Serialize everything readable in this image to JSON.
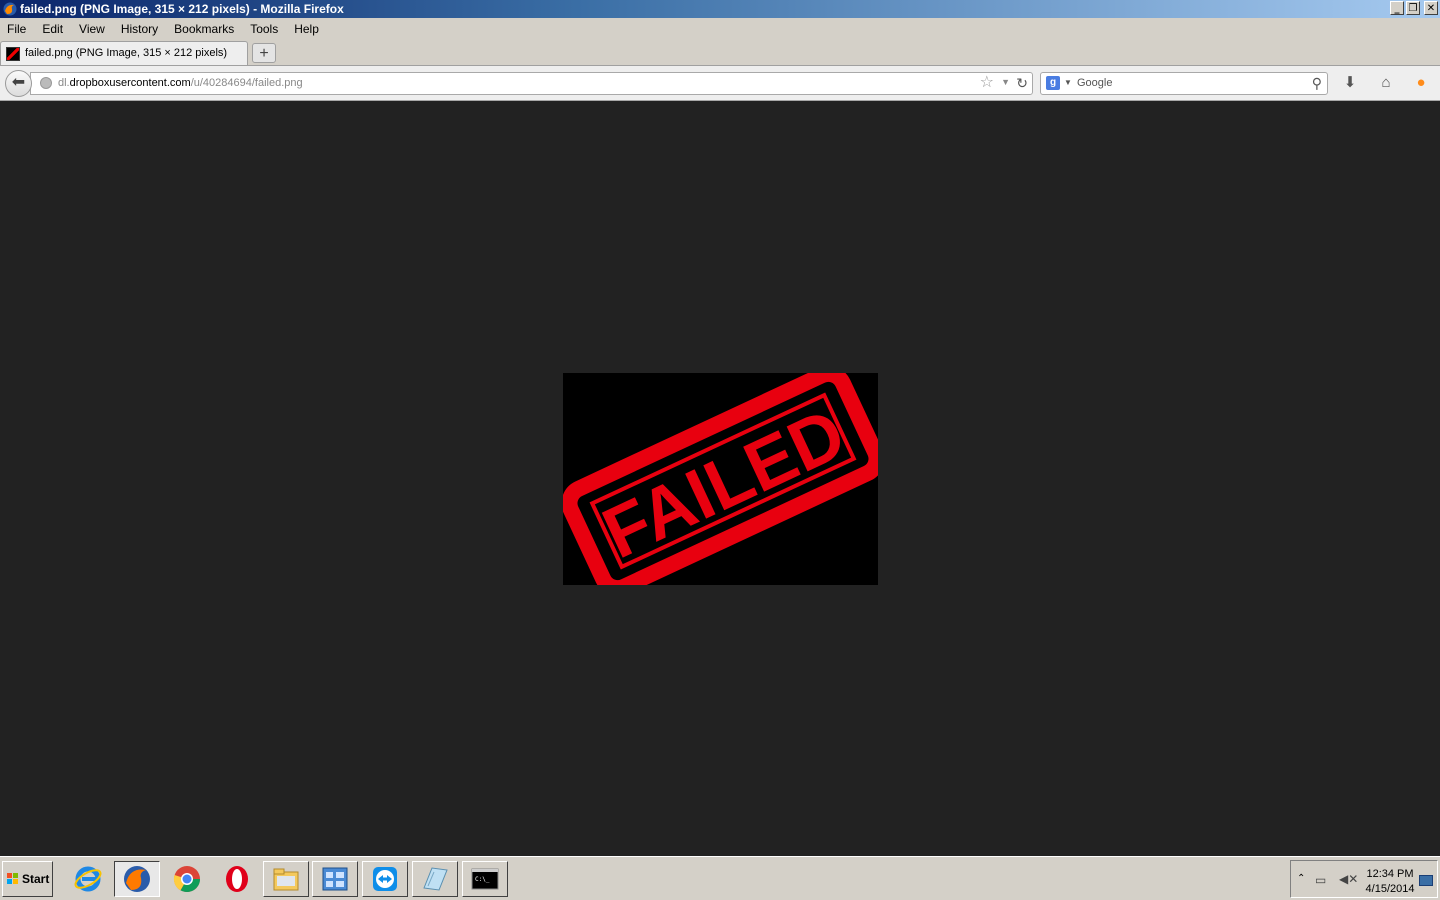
{
  "window": {
    "title": "failed.png (PNG Image, 315 × 212 pixels) - Mozilla Firefox",
    "buttons": [
      "minimize",
      "restore",
      "close"
    ]
  },
  "menubar": {
    "items": [
      {
        "label": "File"
      },
      {
        "label": "Edit"
      },
      {
        "label": "View"
      },
      {
        "label": "History"
      },
      {
        "label": "Bookmarks"
      },
      {
        "label": "Tools"
      },
      {
        "label": "Help"
      }
    ]
  },
  "tabs": {
    "items": [
      {
        "label": "failed.png (PNG Image, 315 × 212 pixels)",
        "active": true
      }
    ],
    "new_tab_label": "+"
  },
  "navbar": {
    "url_prefix": "dl.",
    "url_host": "dropboxusercontent.com",
    "url_path": "/u/40284694/failed.png",
    "search_placeholder": "Google",
    "icons": [
      "back-icon",
      "globe-icon",
      "star-icon",
      "reload-icon",
      "google-icon",
      "search-icon",
      "download-icon",
      "home-icon",
      "persona-icon"
    ]
  },
  "content": {
    "stamp_text": "FAILED",
    "stamp_color": "#e8000f",
    "background_color": "#222222",
    "image_background": "#000000"
  },
  "taskbar": {
    "start_label": "Start",
    "apps": [
      {
        "name": "internet-explorer-icon"
      },
      {
        "name": "firefox-icon",
        "active": true
      },
      {
        "name": "chrome-icon"
      },
      {
        "name": "opera-icon"
      },
      {
        "name": "file-explorer-icon"
      },
      {
        "name": "control-panel-icon"
      },
      {
        "name": "teamviewer-icon"
      },
      {
        "name": "notepad-icon"
      },
      {
        "name": "command-prompt-icon"
      }
    ],
    "clock_time": "12:34 PM",
    "clock_date": "4/15/2014"
  }
}
